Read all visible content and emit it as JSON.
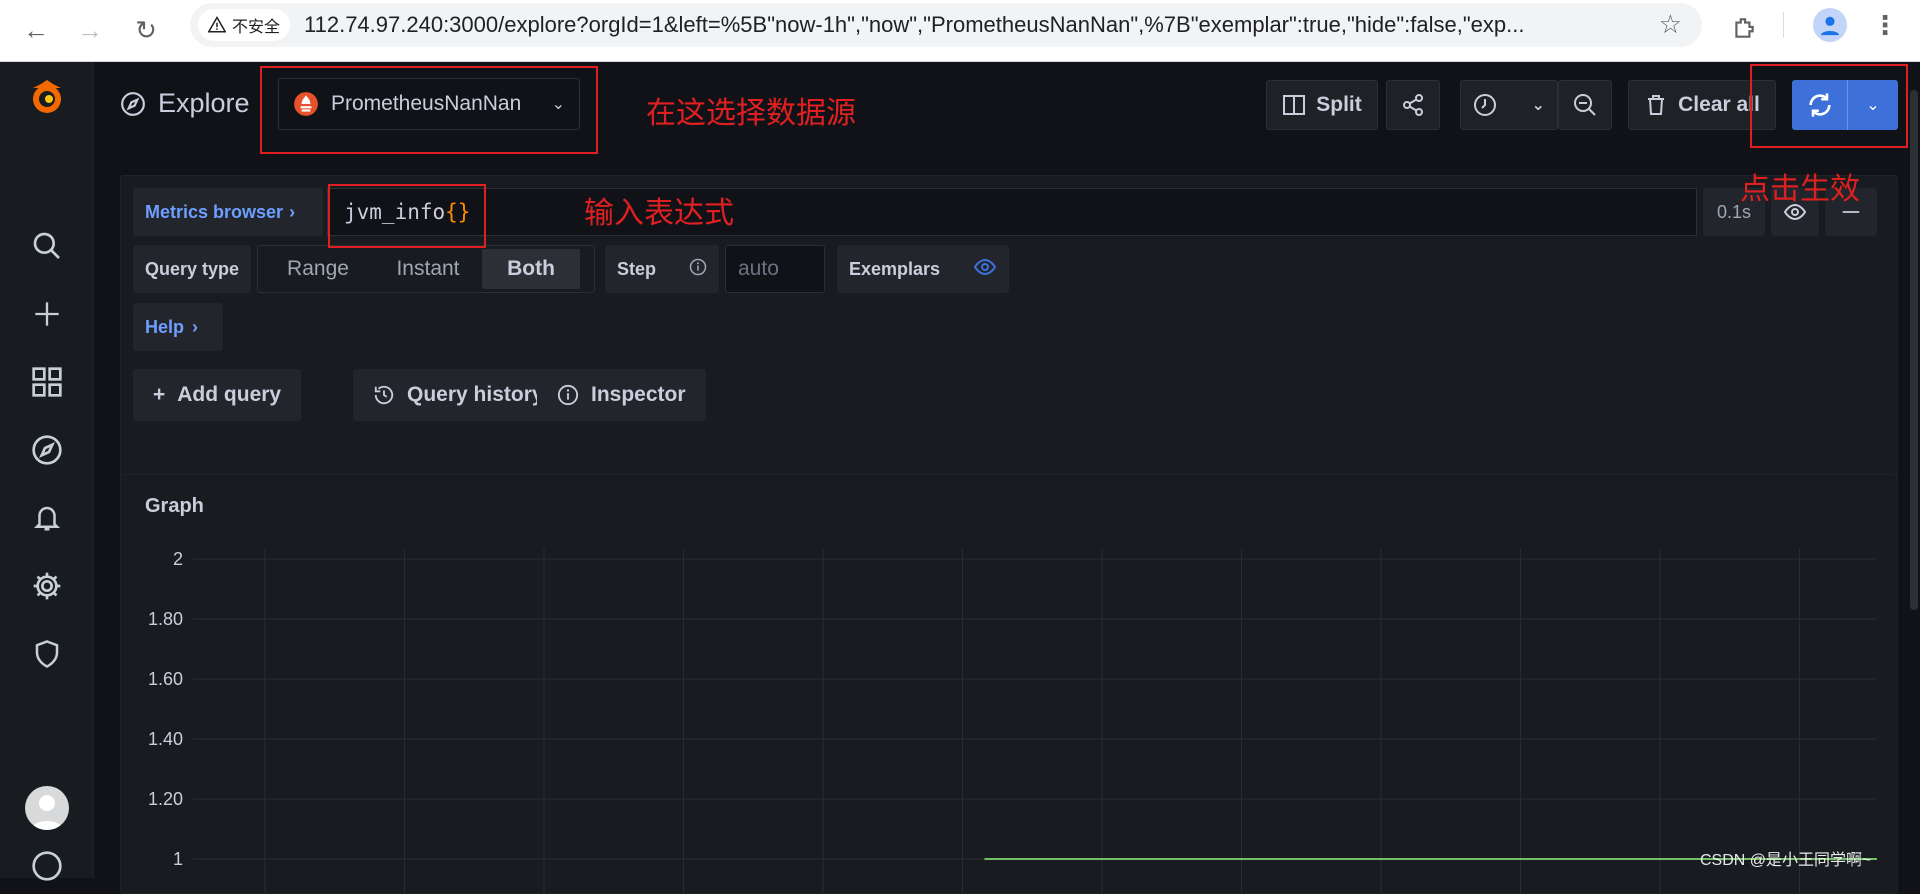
{
  "browser": {
    "security_label": "不安全",
    "url": "112.74.97.240:3000/explore?orgId=1&left=%5B\"now-1h\",\"now\",\"PrometheusNanNan\",%7B\"exemplar\":true,\"hide\":false,\"exp..."
  },
  "header": {
    "title": "Explore",
    "datasource": "PrometheusNanNan",
    "split_label": "Split",
    "clear_all_label": "Clear all"
  },
  "query": {
    "metrics_browser_label": "Metrics browser",
    "expression_text": "jvm_info",
    "expression_braces": "{}",
    "duration": "0.1s",
    "query_type_label": "Query type",
    "query_types": [
      "Range",
      "Instant",
      "Both"
    ],
    "selected_query_type": "Both",
    "step_label": "Step",
    "step_placeholder": "auto",
    "exemplars_label": "Exemplars",
    "help_label": "Help",
    "add_query_label": "Add query",
    "query_history_label": "Query history",
    "inspector_label": "Inspector"
  },
  "graph": {
    "title": "Graph"
  },
  "chart_data": {
    "type": "line",
    "title": "Graph",
    "y_tick_labels": [
      "2",
      "1.80",
      "1.60",
      "1.40",
      "1.20",
      "1"
    ],
    "ylim": [
      0.8,
      2
    ],
    "grid": true,
    "series": [
      {
        "color": "#73bf69",
        "x_start_fraction": 0.47,
        "x_end_fraction": 1.0,
        "values": [
          1,
          1
        ]
      }
    ]
  },
  "annotations": {
    "datasource_note": "在这选择数据源",
    "expression_note": "输入表达式",
    "run_note": "点击生效"
  },
  "watermark": "CSDN @是小王同学啊~",
  "colors": {
    "accent_blue": "#3d71d9",
    "series_green": "#73bf69",
    "annotation_red": "#e02020"
  }
}
